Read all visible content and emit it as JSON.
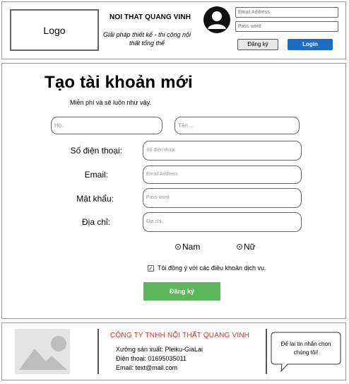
{
  "header": {
    "logo_label": "Logo",
    "brand_name": "NOI THAT QUANG VINH",
    "tagline": "Giải pháp thiết kế - thi công nội thất tổng thể",
    "email_placeholder": "Email Address",
    "password_placeholder": "Pass word",
    "register_label": "Đăng ký",
    "login_label": "Login",
    "login_color": "#1c6dc8"
  },
  "form": {
    "title": "Tạo tài khoản mới",
    "subtitle": "Miễn phí và sẽ luôn như vậy.",
    "last_name_placeholder": "Họ..",
    "first_name_placeholder": "Tên....",
    "phone_label": "Số điện thoại:",
    "phone_placeholder": "Số điện thoại",
    "email_label": "Email:",
    "email_placeholder": "Email Address",
    "password_label": "Mật khẩu:",
    "password_placeholder": "Pass word",
    "address_label": "Địa chỉ:",
    "address_placeholder": "Địa chỉ..",
    "gender_male": "Nam",
    "gender_female": "Nữ",
    "agree_text": "Tôi đồng ý với các điều khoản dịch vụ.",
    "agree_checked": true,
    "submit_label": "Đăng ký",
    "submit_color": "#5cb75c"
  },
  "footer": {
    "company": "CÔNG TY TNHH NỘI THẤT QUANG VINH",
    "company_color": "#d0342a",
    "address": "Xưởng sản xuất: Pleiku-GiaLai",
    "phone": "Điện thoại: 01695035011",
    "email": "Email: text@mail.com",
    "message_bubble": "Để lại tin nhắn chon chúng tôi!"
  }
}
